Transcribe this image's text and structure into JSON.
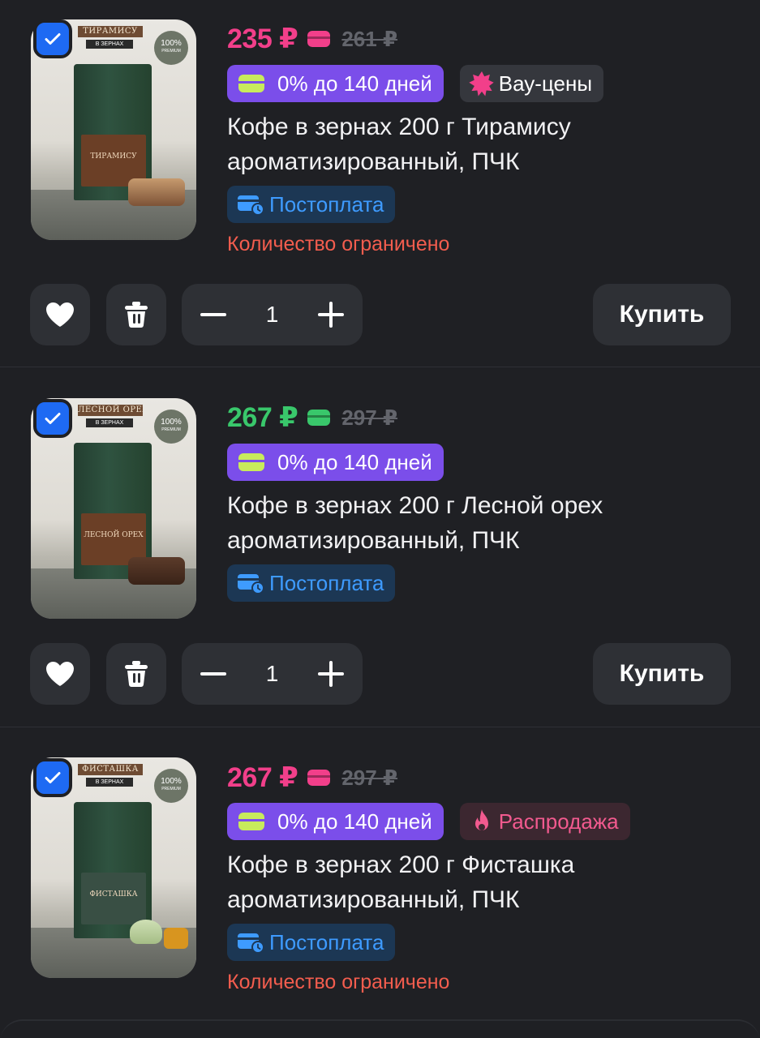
{
  "items": [
    {
      "selected": true,
      "price": "235 ₽",
      "price_color": "#f23f8a",
      "old_price": "261 ₽",
      "installment": "0% до 140 дней",
      "promo": "Вау-цены",
      "promo_icon": "starburst-icon",
      "title": "Кофе в зернах 200 г Тирамису ароматизированный, ПЧК",
      "postpay": "Постоплата",
      "limited": "Количество ограничено",
      "quantity": "1",
      "buy_label": "Купить",
      "image": {
        "tag": "ТИРАМИСУ",
        "sub": "В ЗЕРНАХ",
        "seal": "100%",
        "seal_sub": "PREMIUM",
        "label": "ТИРАМИСУ"
      }
    },
    {
      "selected": true,
      "price": "267 ₽",
      "price_color": "#39c76b",
      "old_price": "297 ₽",
      "installment": "0% до 140 дней",
      "title": "Кофе в зернах 200 г Лесной орех ароматизированный, ПЧК",
      "postpay": "Постоплата",
      "quantity": "1",
      "buy_label": "Купить",
      "image": {
        "tag": "ЛЕСНОЙ ОРЕХ",
        "sub": "В ЗЕРНАХ",
        "seal": "100%",
        "seal_sub": "PREMIUM",
        "label": "ЛЕСНОЙ ОРЕХ"
      }
    },
    {
      "selected": true,
      "price": "267 ₽",
      "price_color": "#f23f8a",
      "old_price": "297 ₽",
      "installment": "0% до 140 дней",
      "promo": "Распродажа",
      "promo_icon": "flame-icon",
      "title": "Кофе в зернах 200 г Фисташка ароматизированный, ПЧК",
      "postpay": "Постоплата",
      "limited": "Количество ограничено",
      "image": {
        "tag": "ФИСТАШКА",
        "sub": "В ЗЕРНАХ",
        "seal": "100%",
        "seal_sub": "PREMIUM",
        "label": "ФИСТАШКА"
      }
    }
  ],
  "icons": {
    "favorite": "heart-icon",
    "delete": "trash-icon",
    "decrement": "minus-icon",
    "increment": "plus-icon",
    "checkbox": "check-icon",
    "postpay": "card-clock-icon"
  }
}
